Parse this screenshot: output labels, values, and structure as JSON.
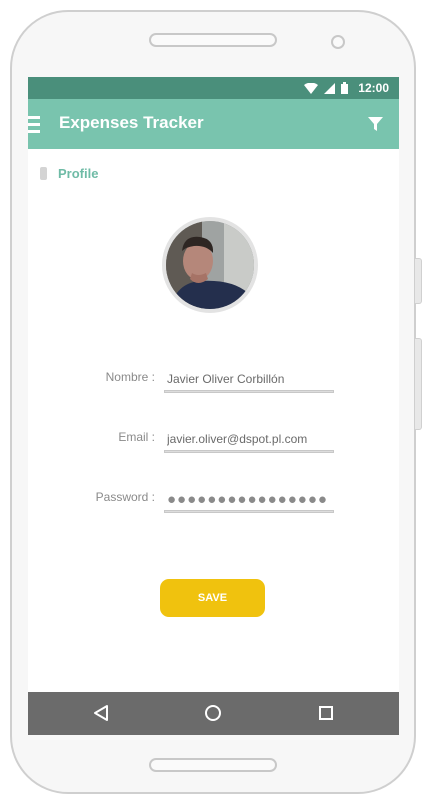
{
  "status_bar": {
    "time": "12:00"
  },
  "app_bar": {
    "title": "Expenses Tracker"
  },
  "section": {
    "label": "Profile"
  },
  "form": {
    "name_label": "Nombre :",
    "name_value": "Javier Oliver Corbillón",
    "email_label": "Email :",
    "email_value": "javier.oliver@dspot.pl.com",
    "password_label": "Password :",
    "password_value": "●●●●●●●●●●●●●●●●"
  },
  "actions": {
    "save_label": "SAVE"
  },
  "colors": {
    "status_bar": "#4a8f7b",
    "app_bar": "#79c4ae",
    "accent_text": "#6fbba6",
    "save_button": "#f0c20e",
    "nav_bar": "#6b6b6b"
  },
  "icons": [
    "menu-icon",
    "filter-icon",
    "wifi-icon",
    "signal-icon",
    "battery-icon",
    "back-icon",
    "home-icon",
    "recents-icon"
  ]
}
